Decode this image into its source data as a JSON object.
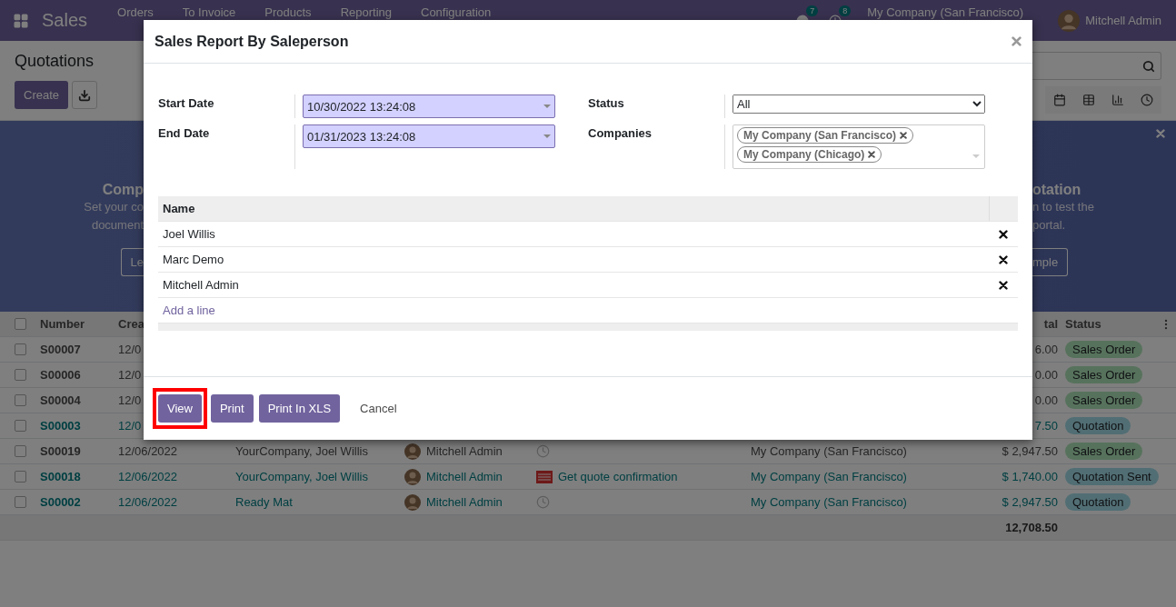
{
  "navbar": {
    "app": "Sales",
    "menu": [
      "Orders",
      "To Invoice",
      "Products",
      "Reporting",
      "Configuration"
    ],
    "messages_count": "7",
    "activities_count": "8",
    "company": "My Company (San Francisco)",
    "user": "Mitchell Admin"
  },
  "control_panel": {
    "title": "Quotations",
    "create_button": "Create"
  },
  "banner": {
    "left": {
      "title": "Comp",
      "lines": [
        "Set your co",
        "document"
      ],
      "button": "Le"
    },
    "right": {
      "title": "otation",
      "lines": [
        "n to test the",
        "portal."
      ],
      "button": "mple"
    }
  },
  "list": {
    "all_checked": false,
    "columns": [
      "Number",
      "Crea",
      "tal",
      "Status"
    ],
    "rows": [
      {
        "number": "S00007",
        "created": "12/0",
        "total": "6.00",
        "status": {
          "label": "Sales Order",
          "kind": "order"
        },
        "checked": false
      },
      {
        "number": "S00006",
        "created": "12/0",
        "total": "0.00",
        "status": {
          "label": "Sales Order",
          "kind": "order"
        },
        "checked": false
      },
      {
        "number": "S00004",
        "created": "12/0",
        "total": "0.00",
        "status": {
          "label": "Sales Order",
          "kind": "order"
        },
        "checked": false
      },
      {
        "number": "S00003",
        "created": "12/0",
        "total": "7.50",
        "status": {
          "label": "Quotation",
          "kind": "quotation"
        },
        "checked": false
      },
      {
        "number": "S00019",
        "created": "12/06/2022",
        "customer": "YourCompany, Joel Willis",
        "salesperson": "Mitchell Admin",
        "activity": {
          "kind": "clock"
        },
        "company": "My Company (San Francisco)",
        "total": "$ 2,947.50",
        "status": {
          "label": "Sales Order",
          "kind": "order"
        },
        "checked": false
      },
      {
        "number": "S00018",
        "created": "12/06/2022",
        "customer": "YourCompany, Joel Willis",
        "salesperson": "Mitchell Admin",
        "activity": {
          "kind": "email",
          "text": "Get quote confirmation"
        },
        "company": "My Company (San Francisco)",
        "total": "$ 1,740.00",
        "status": {
          "label": "Quotation Sent",
          "kind": "quotation"
        },
        "checked": false
      },
      {
        "number": "S00002",
        "created": "12/06/2022",
        "customer": "Ready Mat",
        "salesperson": "Mitchell Admin",
        "activity": {
          "kind": "clock"
        },
        "company": "My Company (San Francisco)",
        "total": "$ 2,947.50",
        "status": {
          "label": "Quotation",
          "kind": "quotation"
        },
        "checked": false
      }
    ],
    "total": "12,708.50"
  },
  "dialog": {
    "title": "Sales Report By Saleperson",
    "fields": [
      {
        "label": "Start Date",
        "value": "10/30/2022 13:24:08"
      },
      {
        "label": "End Date",
        "value": "01/31/2023 13:24:08"
      }
    ],
    "status": {
      "label": "Status",
      "value": "All"
    },
    "companies": {
      "label": "Companies",
      "tags": [
        "My Company (San Francisco)",
        "My Company (Chicago)"
      ]
    },
    "table": {
      "column": "Name",
      "rows": [
        "Joel Willis",
        "Marc Demo",
        "Mitchell Admin"
      ],
      "add_line": "Add a line"
    },
    "buttons": [
      {
        "label": "View",
        "kind": "primary",
        "highlighted": true
      },
      {
        "label": "Print",
        "kind": "primary",
        "highlighted": false
      },
      {
        "label": "Print In XLS",
        "kind": "primary",
        "highlighted": false
      },
      {
        "label": "Cancel",
        "kind": "link",
        "highlighted": false
      }
    ]
  }
}
